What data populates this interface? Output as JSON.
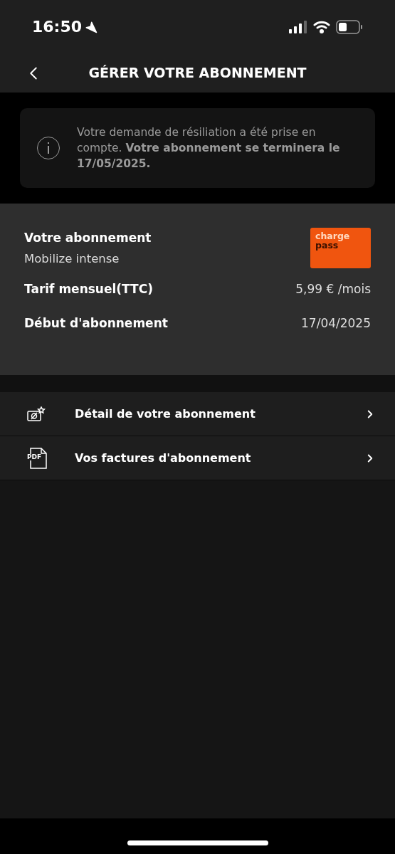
{
  "status_bar": {
    "time": "16:50"
  },
  "header": {
    "title": "GÉRER VOTRE ABONNEMENT"
  },
  "notice": {
    "message": "Votre demande de résiliation a été prise en compte. **Votre abonnement se terminera le 17/05/2025.**"
  },
  "subscription": {
    "label": "Votre abonnement",
    "plan": "Mobilize intense",
    "logo": [
      "charge",
      "pass"
    ],
    "rows": [
      {
        "label": "Tarif mensuel(TTC)",
        "value": "5,99 € /mois"
      },
      {
        "label": "Début d'abonnement",
        "value": "17/04/2025"
      }
    ]
  },
  "menu": [
    {
      "kind": "card",
      "label": "Détail de votre abonnement"
    },
    {
      "kind": "pdf",
      "icon_text": "PDF",
      "label": "Vos factures d'abonnement"
    }
  ]
}
